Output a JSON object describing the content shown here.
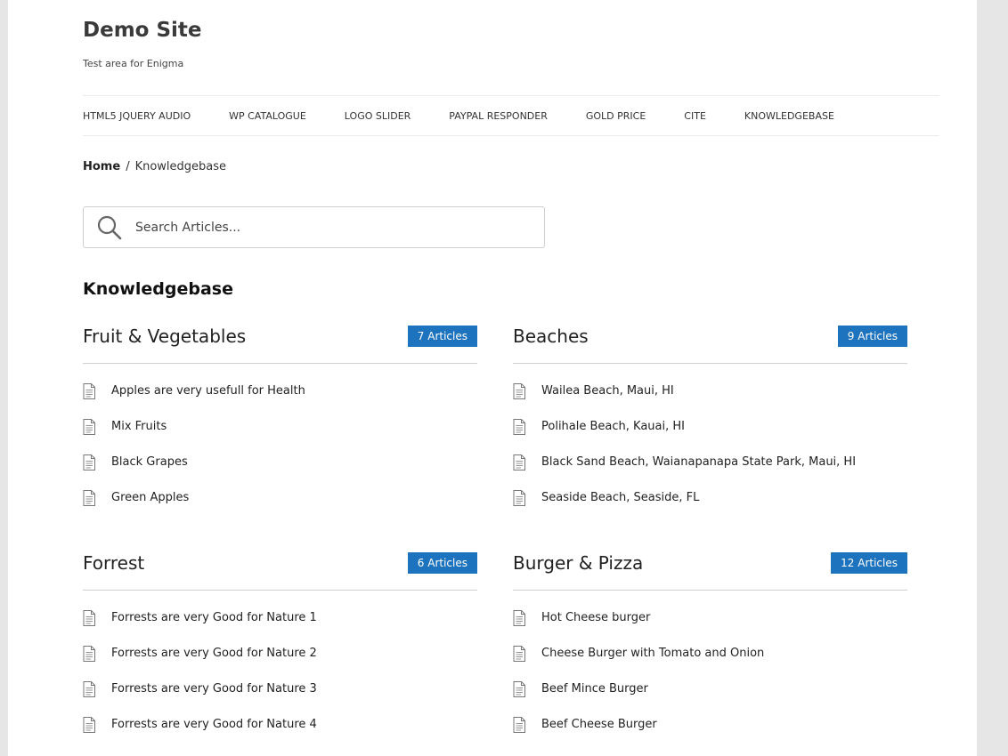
{
  "site": {
    "title": "Demo Site",
    "description": "Test area for Enigma"
  },
  "nav": {
    "items": [
      {
        "label": "HTML5 JQUERY AUDIO"
      },
      {
        "label": "WP CATALOGUE"
      },
      {
        "label": "LOGO SLIDER"
      },
      {
        "label": "PAYPAL RESPONDER"
      },
      {
        "label": "GOLD PRICE"
      },
      {
        "label": "CITE"
      },
      {
        "label": "KNOWLEDGEBASE"
      }
    ]
  },
  "breadcrumb": {
    "home": "Home",
    "separator": "/",
    "current": "Knowledgebase"
  },
  "search": {
    "placeholder": "Search Articles...",
    "icon": "search-icon"
  },
  "heading": "Knowledgebase",
  "colors": {
    "badge": "#1e73be",
    "divider": "#cfcfcf",
    "background": "#e6e6e6"
  },
  "categories": [
    {
      "title": "Fruit & Vegetables",
      "badge": "7 Articles",
      "articles": [
        "Apples are very usefull for Health",
        "Mix Fruits",
        "Black Grapes",
        "Green Apples"
      ]
    },
    {
      "title": "Beaches",
      "badge": "9 Articles",
      "articles": [
        "Wailea Beach, Maui, HI",
        "Polihale Beach, Kauai, HI",
        "Black Sand Beach, Waianapanapa State Park, Maui, HI",
        "Seaside Beach, Seaside, FL"
      ]
    },
    {
      "title": "Forrest",
      "badge": "6 Articles",
      "articles": [
        "Forrests are very Good for Nature 1",
        "Forrests are very Good for Nature 2",
        "Forrests are very Good for Nature 3",
        "Forrests are very Good for Nature 4"
      ]
    },
    {
      "title": "Burger & Pizza",
      "badge": "12 Articles",
      "articles": [
        "Hot Cheese burger",
        "Cheese Burger with Tomato and Onion",
        "Beef Mince Burger",
        "Beef Cheese Burger"
      ]
    }
  ]
}
